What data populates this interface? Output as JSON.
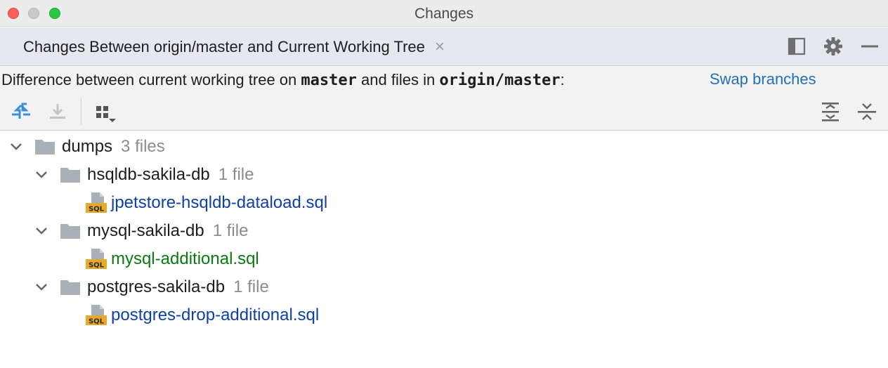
{
  "window": {
    "title": "Changes"
  },
  "tab": {
    "label": "Changes Between origin/master and Current Working Tree",
    "close_glyph": "×"
  },
  "tab_actions": {
    "layout_icon": "panel-layout-icon",
    "settings_icon": "gear-icon",
    "hide_icon": "minimize-icon"
  },
  "description": {
    "prefix": "Difference between current working tree on",
    "branch_current": "master",
    "middle": "and files in",
    "branch_remote": "origin/master",
    "suffix": ":",
    "swap_link": "Swap branches"
  },
  "toolbar": {
    "left": [
      "show-diff-icon",
      "download-icon",
      "group-by-icon"
    ],
    "right": [
      "expand-all-icon",
      "collapse-all-icon"
    ]
  },
  "tree": {
    "root": {
      "name": "dumps",
      "count": "3 files"
    },
    "groups": [
      {
        "name": "hsqldb-sakila-db",
        "count": "1 file",
        "file": "jpetstore-hsqldb-dataload.sql",
        "status": "modified"
      },
      {
        "name": "mysql-sakila-db",
        "count": "1 file",
        "file": "mysql-additional.sql",
        "status": "added"
      },
      {
        "name": "postgres-sakila-db",
        "count": "1 file",
        "file": "postgres-drop-additional.sql",
        "status": "modified"
      }
    ]
  },
  "colors": {
    "modified": "#0f3fa8",
    "added": "#0b7a11",
    "link": "#2470b3",
    "folder": "#a9b0b8",
    "sql_badge": "#e6a92a"
  }
}
